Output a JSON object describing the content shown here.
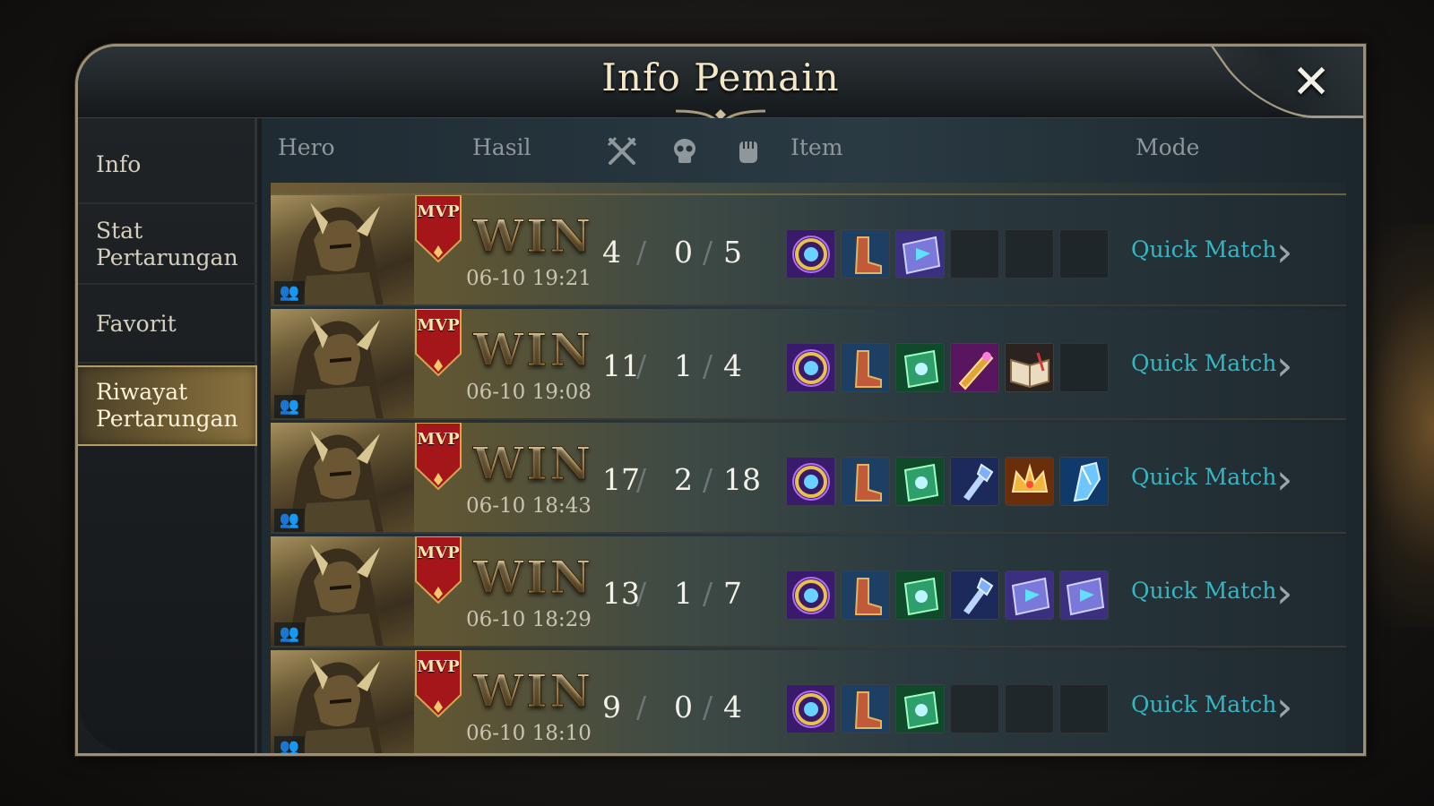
{
  "window": {
    "title": "Info Pemain",
    "close_icon": "close-icon"
  },
  "sidebar": {
    "items": [
      {
        "label": "Info",
        "active": false
      },
      {
        "label": "Stat Pertarungan",
        "active": false
      },
      {
        "label": "Favorit",
        "active": false
      },
      {
        "label": "Riwayat Pertarungan",
        "active": true
      }
    ]
  },
  "table": {
    "headers": {
      "hero": "Hero",
      "result": "Hasil",
      "kills_icon": "crossed-swords-icon",
      "deaths_icon": "skull-icon",
      "assists_icon": "fist-icon",
      "item": "Item",
      "mode": "Mode"
    },
    "rows": [
      {
        "mvp": "MVP",
        "result": "WIN",
        "date": "06-10 19:21",
        "kills": "4",
        "deaths": "0",
        "assists": "5",
        "items": [
          "purple-amulet",
          "boots",
          "blue-tome",
          "empty",
          "empty",
          "empty"
        ],
        "mode": "Quick Match"
      },
      {
        "mvp": "MVP",
        "result": "WIN",
        "date": "06-10 19:08",
        "kills": "11",
        "deaths": "1",
        "assists": "4",
        "items": [
          "purple-amulet",
          "boots",
          "green-tome",
          "golden-scroll",
          "open-book",
          "empty"
        ],
        "mode": "Quick Match"
      },
      {
        "mvp": "MVP",
        "result": "WIN",
        "date": "06-10 18:43",
        "kills": "17",
        "deaths": "2",
        "assists": "18",
        "items": [
          "purple-amulet",
          "boots",
          "green-tome",
          "crystal-staff",
          "golden-crown",
          "ice-shard"
        ],
        "mode": "Quick Match"
      },
      {
        "mvp": "MVP",
        "result": "WIN",
        "date": "06-10 18:29",
        "kills": "13",
        "deaths": "1",
        "assists": "7",
        "items": [
          "purple-amulet",
          "boots",
          "green-tome",
          "crystal-staff",
          "blue-tome",
          "blue-tome"
        ],
        "mode": "Quick Match"
      },
      {
        "mvp": "MVP",
        "result": "WIN",
        "date": "06-10 18:10",
        "kills": "9",
        "deaths": "0",
        "assists": "4",
        "items": [
          "purple-amulet",
          "boots",
          "green-tome",
          "empty",
          "empty",
          "empty"
        ],
        "mode": "Quick Match"
      }
    ]
  },
  "colors": {
    "title": "#f3e7c7",
    "mode_link": "#34b7c3",
    "active_tab": "#6c5a32",
    "header_text": "#8f979b"
  }
}
